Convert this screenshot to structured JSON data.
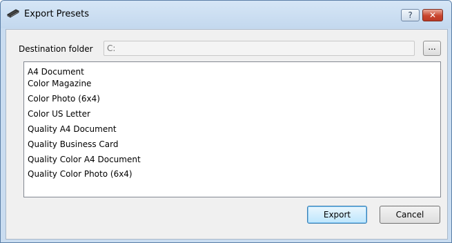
{
  "window": {
    "title": "Export Presets",
    "icon": "scanner-icon",
    "help_label": "?",
    "close_label": "✕"
  },
  "destination": {
    "label": "Destination folder",
    "value": "C:",
    "browse_label": "..."
  },
  "presets": [
    "A4 Document",
    "Color Magazine",
    "Color Photo (6x4)",
    "Color US Letter",
    "Quality A4 Document",
    "Quality Business Card",
    "Quality Color A4 Document",
    "Quality Color Photo (6x4)"
  ],
  "buttons": {
    "export_label": "Export",
    "cancel_label": "Cancel"
  },
  "colors": {
    "title_bar": "#c9dcf0",
    "close_button": "#c9452e",
    "default_button_border": "#3c7fb1"
  }
}
